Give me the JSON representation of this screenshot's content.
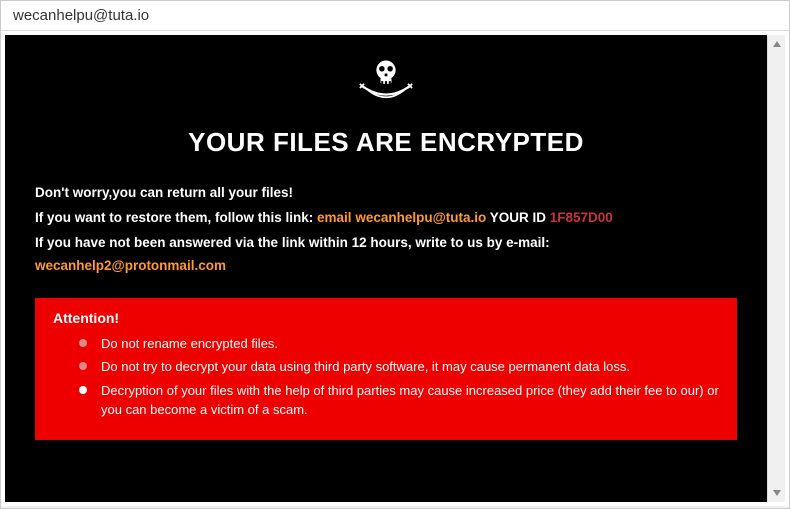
{
  "window": {
    "title": "wecanhelpu@tuta.io"
  },
  "content": {
    "headline": "YOUR FILES ARE ENCRYPTED",
    "line1": "Don't worry,you can return all your files!",
    "line2_prefix": "If you want to restore them, follow this link: ",
    "line2_email_label": "email ",
    "line2_email": "wecanhelpu@tuta.io",
    "line2_id_label": "  YOUR ID ",
    "line2_id": "1F857D00",
    "line3_prefix": "If you have not been answered via the link within 12 hours, write to us by e-mail: ",
    "line3_email": "wecanhelp2@protonmail.com"
  },
  "attention": {
    "title": "Attention!",
    "items": [
      "Do not rename encrypted files.",
      "Do not try to decrypt your data using third party software, it may cause permanent data loss.",
      "Decryption of your files with the help of third parties may cause increased price (they add their fee to our) or you can become a victim of a scam."
    ]
  },
  "colors": {
    "background": "#000000",
    "attention_bg": "#ee0000",
    "accent_orange": "#ff9933",
    "accent_red": "#cc3333"
  }
}
